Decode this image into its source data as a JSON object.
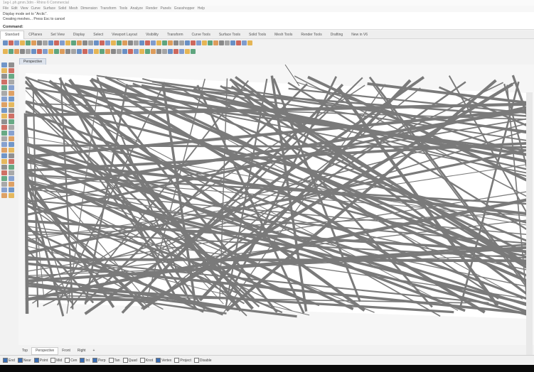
{
  "window": {
    "title": "1eg-l..ph.gmm.3dm - Rhino 6 Commercial"
  },
  "menu": [
    "File",
    "Edit",
    "View",
    "Curve",
    "Surface",
    "Solid",
    "Mesh",
    "Dimension",
    "Transform",
    "Tools",
    "Analyze",
    "Render",
    "Panels",
    "Grasshopper",
    "Help"
  ],
  "command_history": [
    "Display mode set to \"Arctic\".",
    "Creating meshes... Press Esc to cancel"
  ],
  "command_prompt": "Command:",
  "toolbar_tabs": [
    "Standard",
    "CPlanes",
    "Set View",
    "Display",
    "Select",
    "Viewport Layout",
    "Visibility",
    "Transform",
    "Curve Tools",
    "Surface Tools",
    "Solid Tools",
    "Mesh Tools",
    "Render Tools",
    "Drafting",
    "New in V6"
  ],
  "active_toolbar_tab": "Standard",
  "viewport": {
    "label": "Perspective",
    "display_mode": "Arctic"
  },
  "viewport_tabs": [
    "Top",
    "Perspective",
    "Front",
    "Right"
  ],
  "active_viewport_tab": "Perspective",
  "add_tab_symbol": "+",
  "osnaps": [
    {
      "label": "End",
      "checked": true
    },
    {
      "label": "Near",
      "checked": true
    },
    {
      "label": "Point",
      "checked": true
    },
    {
      "label": "Mid",
      "checked": false
    },
    {
      "label": "Cen",
      "checked": false
    },
    {
      "label": "Int",
      "checked": true
    },
    {
      "label": "Perp",
      "checked": true
    },
    {
      "label": "Tan",
      "checked": false
    },
    {
      "label": "Quad",
      "checked": false
    },
    {
      "label": "Knot",
      "checked": false
    },
    {
      "label": "Vertex",
      "checked": true
    },
    {
      "label": "Project",
      "checked": false
    },
    {
      "label": "Disable",
      "checked": false
    }
  ],
  "colors": {
    "band": "#7a7a7a",
    "panel": "#f6f6f6",
    "accent": "#3b6fb6"
  },
  "icons": [
    "new-file-icon",
    "open-icon",
    "save-icon",
    "print-icon",
    "undo-icon",
    "redo-icon",
    "pan-icon",
    "rotate-icon",
    "zoom-icon",
    "select-icon",
    "render-icon",
    "material-icon"
  ]
}
